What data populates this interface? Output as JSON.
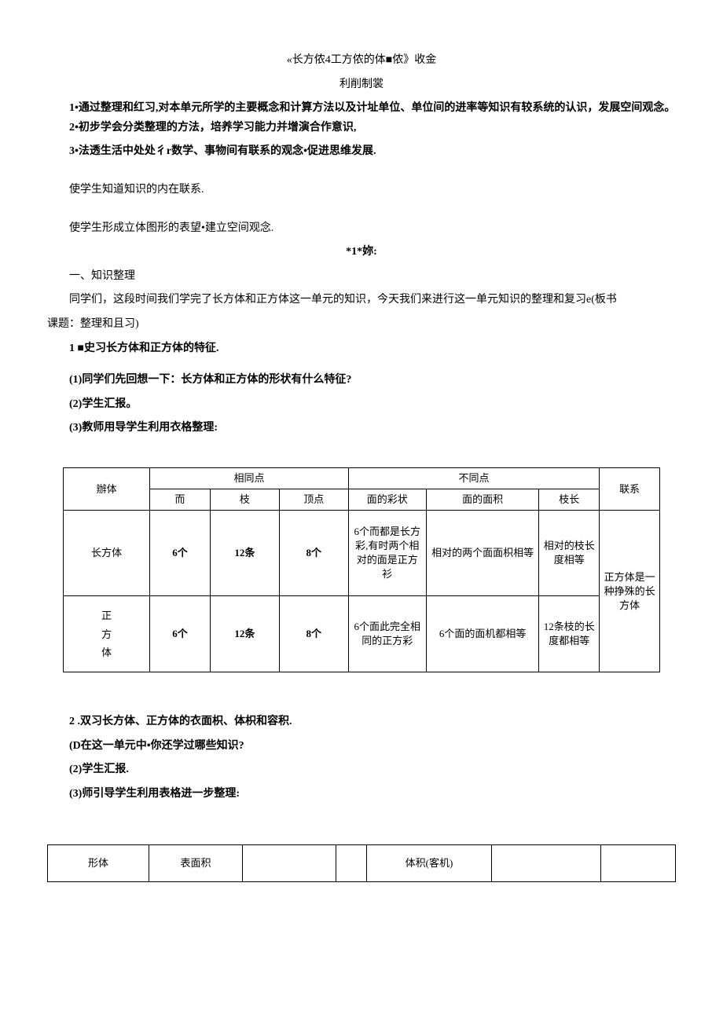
{
  "title": "«长方侬4工方侬的体■侬》收金",
  "subtitle": "利削制裳",
  "paras": {
    "p1": "1•通过整理和红习,对本单元所学的主要概念和计算方法以及计址单位、单位间的进率等知识有较系统的认识，发展空间观念。",
    "p2": "2•初步学会分类整理的方法，培养学习能力并增演合作意识,",
    "p3": "3•法透生活中处处彳r数学、事物间有联系的观念•促进思维发展.",
    "p4": "使学生知道知识的内在联系.",
    "p5": "使学生形成立体图形的表望•建立空间观念.",
    "starline": "*1*妳:",
    "sec1": "一、知识整理",
    "p6a": "同学们，这段时间我们学完了长方体和正方体这一单元的知识，今天我们来进行这一单元知识的整理和复习e(板书",
    "p6b": "课题：整理和且习)",
    "p7": "1 ■史习长方体和正方体的特征.",
    "p8": "(1)同学们先回想一下：长方体和正方体的形状有什么特征?",
    "p9": "(2)学生汇报。",
    "p10": "(3)教师用导学生利用衣格整理:",
    "p11": "2 .双习长方体、正方体的衣面枳、体枳和容积.",
    "p12": "(D在这一单元中•你还学过哪些知识?",
    "p13": "(2)学生汇报.",
    "p14": "(3)师引导学生利用表格进一步整理:"
  },
  "table1": {
    "h_same": "相同点",
    "h_diff": "不同点",
    "h_rel": "联系",
    "h_body": "辦体",
    "h_face": "而",
    "h_edge": "枝",
    "h_vertex": "顶点",
    "h_shape": "面的彩状",
    "h_area": "面的面积",
    "h_len": "枝长",
    "r1": {
      "name": "长方体",
      "face": "6个",
      "edge": "12条",
      "vertex": "8个",
      "shape": "6个而都是长方彩,有时两个相对的面是正方衫",
      "area": "相对的两个面面枳相等",
      "len": "相对的枝长度相等"
    },
    "r2a": "正",
    "r2b": "方",
    "r2c": "体",
    "r2": {
      "face": "6个",
      "edge": "12条",
      "vertex": "8个",
      "shape": "6个面此完全相同的正方彩",
      "area": "6个面的面机都相等",
      "len": "12条枝的长度都相等"
    },
    "rel": "正方体是一种挣殊的长方体"
  },
  "table2": {
    "h1": "形体",
    "h2": "表面积",
    "h3": "体积(客机)"
  }
}
